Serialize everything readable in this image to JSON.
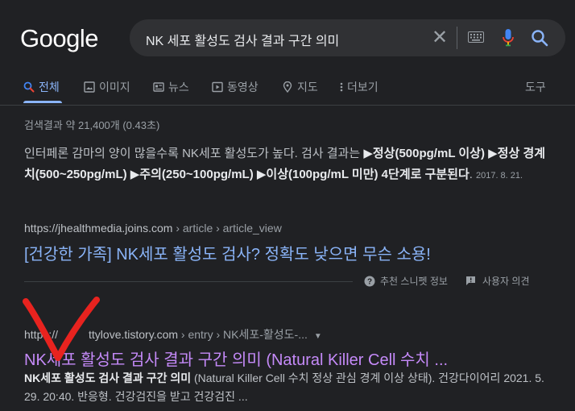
{
  "logo": {
    "text": "Google"
  },
  "search": {
    "query": "NK 세포 활성도 검사 결과 구간 의미",
    "icons": [
      "close-icon",
      "keyboard-icon",
      "mic-icon",
      "search-icon"
    ]
  },
  "tabs": [
    {
      "label": "전체",
      "icon": "search-icon",
      "active": true
    },
    {
      "label": "이미지",
      "icon": "image-icon",
      "active": false
    },
    {
      "label": "뉴스",
      "icon": "news-icon",
      "active": false
    },
    {
      "label": "동영상",
      "icon": "video-icon",
      "active": false
    },
    {
      "label": "지도",
      "icon": "map-pin-icon",
      "active": false
    },
    {
      "label": "더보기",
      "icon": "more-vert-icon",
      "active": false
    },
    {
      "label": "도구",
      "icon": "",
      "active": false
    }
  ],
  "stats": "검색결과 약 21,400개 (0.43초)",
  "featured_snippet": {
    "text_plain": "인터페론 감마의 양이 많을수록 NK세포 활성도가 높다. 검사 결과는 ",
    "text_bold": "▶정상(500pg/mL 이상) ▶정상 경계치(500~250pg/mL) ▶주의(250~100pg/mL) ▶이상(100pg/mL 미만) 4단계로 구분된다",
    "text_end": ".",
    "date": "2017. 8. 21.",
    "cite_domain": "https://jhealthmedia.joins.com",
    "cite_path": " › article › article_view",
    "title": "[건강한 가족] NK세포 활성도 검사? 정확도 낮으면 무슨 소용!",
    "footer_about": "추천 스니펫 정보",
    "footer_feedback": "사용자 의견"
  },
  "result2": {
    "cite_domain": "https://",
    "cite_domain_rest": "ttylove.tistory.com",
    "cite_path": " › entry › NK세포-활성도-...",
    "title": "NK세포 활성도 검사 결과 구간 의미 (Natural Killer Cell 수치 ...",
    "snippet_bold": "NK세포 활성도 검사 결과 구간 의미",
    "snippet_rest": " (Natural Killer Cell 수치 정상 관심 경계 이상 상태). 건강다이어리 2021. 5. 29. 20:40. 반응형. 건강검진을 받고 건강검진 ..."
  },
  "colors": {
    "background": "#202124",
    "link_blue": "#8ab4f8",
    "visited_purple": "#c58af9",
    "checkmark_red": "#e8231f"
  }
}
